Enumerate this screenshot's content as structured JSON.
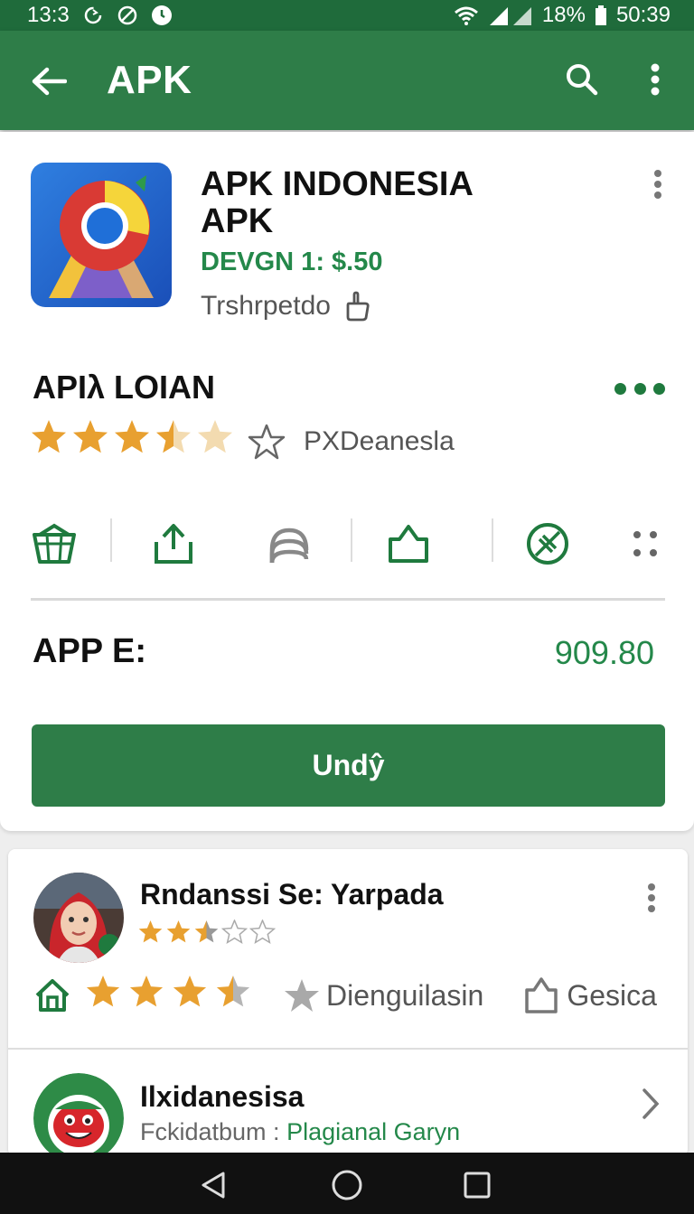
{
  "status_bar": {
    "time_left": "13:3",
    "battery": "18%",
    "clock": "50:39",
    "icons": [
      "sync-icon",
      "no-disturb-icon",
      "alarm-icon",
      "wifi-icon",
      "signal-icon",
      "battery-icon"
    ]
  },
  "app_bar": {
    "title": "APK",
    "icons": [
      "back-arrow-icon",
      "search-icon",
      "more-vert-icon"
    ]
  },
  "app": {
    "title_line1": "APK INDONESIA",
    "title_line2": "APK",
    "developer": "DEVGN 1: $.50",
    "subtitle": "Trshrpetdo"
  },
  "section": {
    "title": "APIλ LOIAN",
    "rating_label": "PXDeanesla",
    "rating": 3.5,
    "rating_max": 5
  },
  "actions": [
    "basket-icon",
    "upload-icon",
    "rainbow-icon",
    "share-icon",
    "cancel-icon",
    "grid-dots-icon"
  ],
  "price": {
    "label": "APP E:",
    "value": "909.80"
  },
  "cta": {
    "label": "Undŷ"
  },
  "review": {
    "name": "Rndanssi Se: Yarpada",
    "stars": 2.5,
    "action_rating": 3.5,
    "label1": "Dienguilasin",
    "label2": "Gesica"
  },
  "list_item": {
    "title": "Ilxidanesisa",
    "sub_gray": "Fckidatbum : ",
    "sub_green": "Plagianal Garyn"
  },
  "colors": {
    "primary": "#2e7d48",
    "status_bar": "#1f6b3b",
    "accent_green": "#24884a",
    "star": "#e8a030"
  }
}
